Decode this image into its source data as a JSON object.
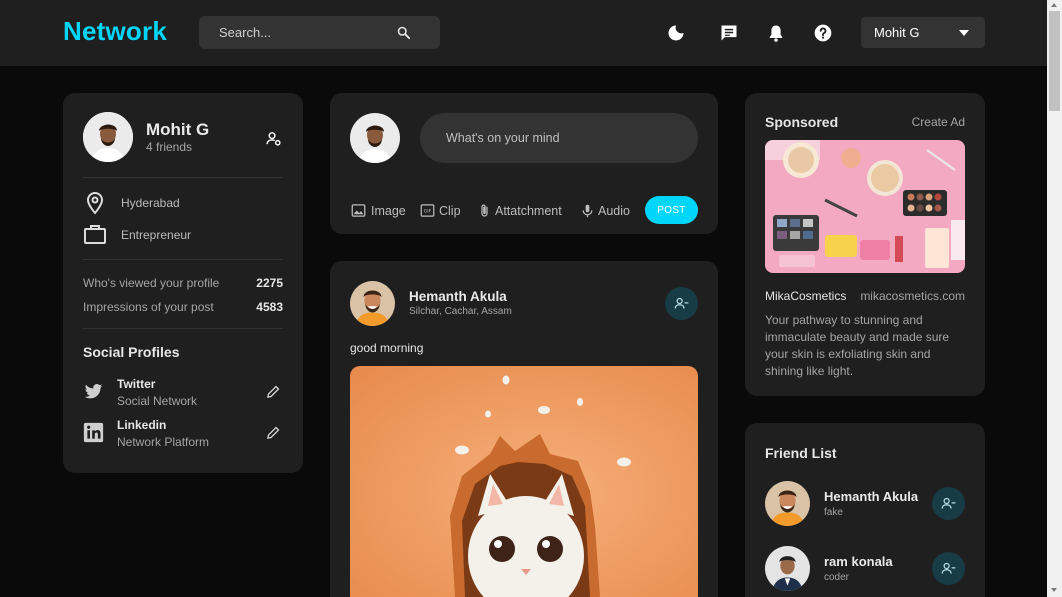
{
  "navbar": {
    "logo": "Network",
    "search_placeholder": "Search...",
    "user_name": "Mohit G",
    "icons": [
      "moon-icon",
      "message-icon",
      "bell-icon",
      "help-icon"
    ]
  },
  "profile": {
    "name": "Mohit G",
    "friends": "4 friends",
    "location": "Hyderabad",
    "occupation": "Entrepreneur",
    "stats": [
      {
        "label": "Who's viewed your profile",
        "value": "2275"
      },
      {
        "label": "Impressions of your post",
        "value": "4583"
      }
    ],
    "social_title": "Social Profiles",
    "social": [
      {
        "name": "Twitter",
        "sub": "Social Network",
        "icon": "twitter-icon"
      },
      {
        "name": "Linkedin",
        "sub": "Network Platform",
        "icon": "linkedin-icon"
      }
    ]
  },
  "composer": {
    "placeholder": "What's on your mind",
    "actions": [
      "Image",
      "Clip",
      "Attatchment",
      "Audio"
    ],
    "post_label": "POST"
  },
  "post": {
    "author": "Hemanth Akula",
    "location": "Silchar, Cachar, Assam",
    "text": "good morning"
  },
  "sponsored": {
    "title": "Sponsored",
    "create": "Create Ad",
    "brand": "MikaCosmetics",
    "url": "mikacosmetics.com",
    "description": "Your pathway to stunning and immaculate beauty and made sure your skin is exfoliating skin and shining like light."
  },
  "friend_list": {
    "title": "Friend List",
    "friends": [
      {
        "name": "Hemanth Akula",
        "sub": "fake"
      },
      {
        "name": "ram konala",
        "sub": "coder"
      }
    ]
  },
  "colors": {
    "accent": "#00d5fa",
    "background": "#0a0a0a",
    "card": "#1f1f1f",
    "navbar": "#1f1f1f"
  }
}
